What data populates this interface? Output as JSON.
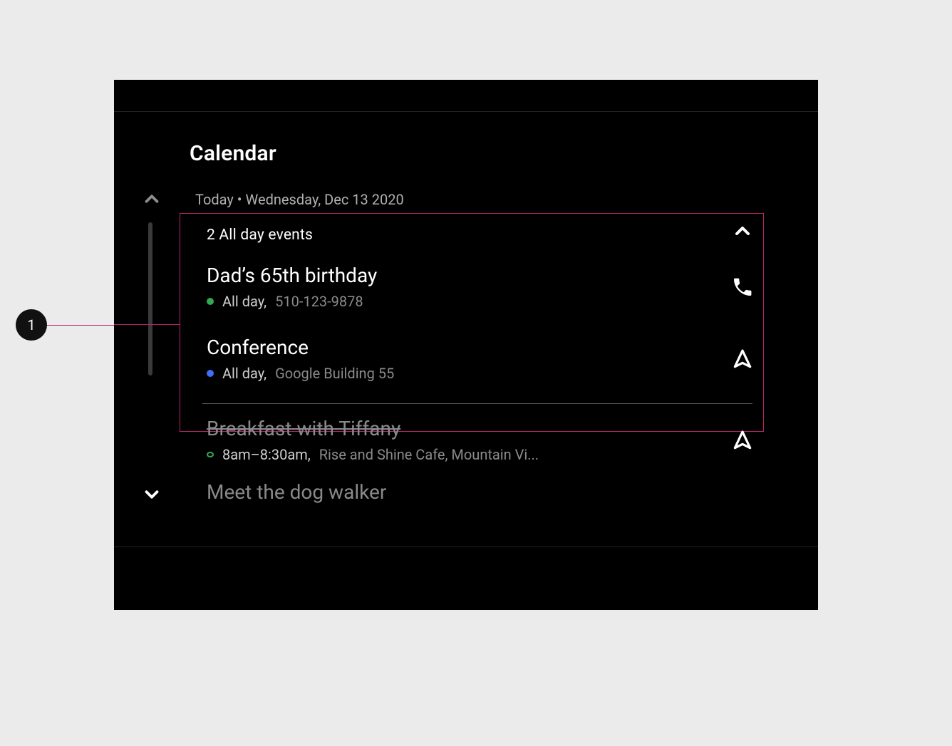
{
  "annotation": {
    "badge": "1"
  },
  "header": {
    "title": "Calendar",
    "date_line": "Today • Wednesday, Dec 13 2020"
  },
  "allday": {
    "header": "2 All day events",
    "events": [
      {
        "title": "Dad’s 65th birthday",
        "time_prefix": "All day,",
        "detail": "510-123-9878",
        "dot_color": "green",
        "action": "phone"
      },
      {
        "title": "Conference",
        "time_prefix": "All day,",
        "detail": "Google Building 55",
        "dot_color": "blue",
        "action": "navigate"
      }
    ]
  },
  "events": [
    {
      "title": "Breakfast with Tiffany",
      "time_prefix": "8am–8:30am,",
      "detail": "Rise and Shine Cafe, Mountain Vi...",
      "dot_color": "open-green",
      "action": "navigate",
      "strike": true
    },
    {
      "title": "Meet the dog walker"
    }
  ]
}
